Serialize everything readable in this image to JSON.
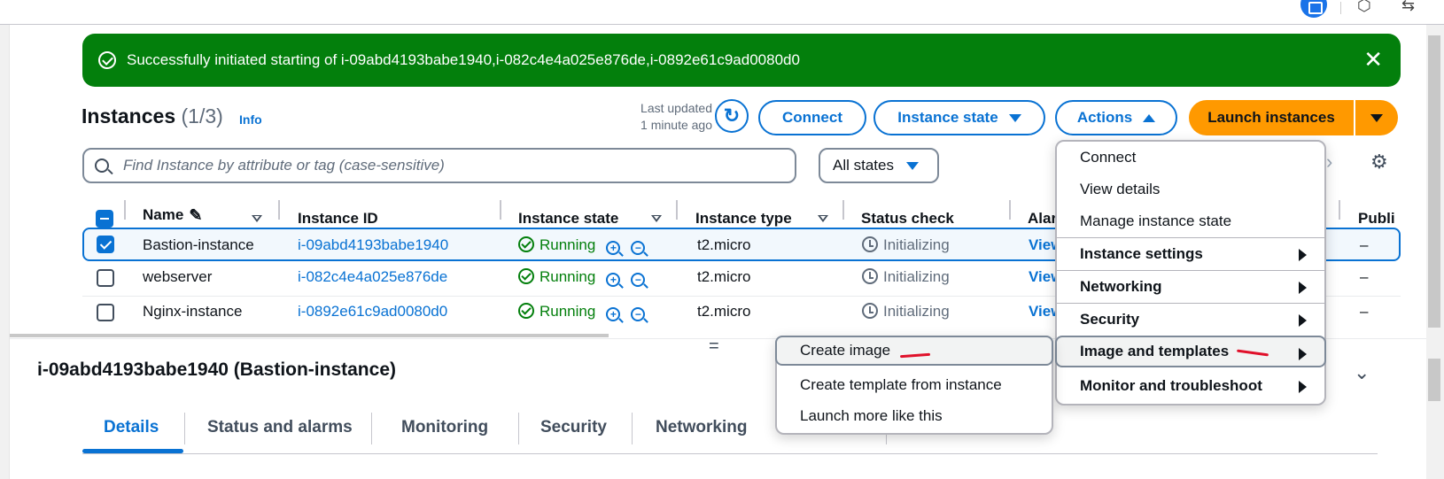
{
  "flash": {
    "message": "Successfully initiated starting of i-09abd4193babe1940,i-082c4e4a025e876de,i-0892e61c9ad0080d0",
    "color": "#037f0c"
  },
  "header": {
    "title": "Instances",
    "count": "(1/3)",
    "info": "Info",
    "last_updated_line1": "Last updated",
    "last_updated_line2": "1 minute ago"
  },
  "toolbar": {
    "connect": "Connect",
    "instance_state": "Instance state",
    "actions": "Actions",
    "launch": "Launch instances"
  },
  "filter": {
    "search_placeholder": "Find Instance by attribute or tag (case-sensitive)",
    "states": "All states"
  },
  "table": {
    "columns": [
      "Name",
      "Instance ID",
      "Instance state",
      "Instance type",
      "Status check",
      "Alar",
      "Publi"
    ],
    "rows": [
      {
        "name": "Bastion-instance",
        "id": "i-09abd4193babe1940",
        "state": "Running",
        "type": "t2.micro",
        "status": "Initializing",
        "alarm": "View",
        "public": "–",
        "selected": true
      },
      {
        "name": "webserver",
        "id": "i-082c4e4a025e876de",
        "state": "Running",
        "type": "t2.micro",
        "status": "Initializing",
        "alarm": "View",
        "public": "–",
        "selected": false
      },
      {
        "name": "Nginx-instance",
        "id": "i-0892e61c9ad0080d0",
        "state": "Running",
        "type": "t2.micro",
        "status": "Initializing",
        "alarm": "View",
        "public": "–",
        "selected": false
      }
    ]
  },
  "details": {
    "title": "i-09abd4193babe1940 (Bastion-instance)",
    "tabs": [
      "Details",
      "Status and alarms",
      "Monitoring",
      "Security",
      "Networking"
    ],
    "splitter": "="
  },
  "actions_menu": {
    "items": [
      {
        "label": "Connect",
        "bold": false
      },
      {
        "label": "View details",
        "bold": false
      },
      {
        "label": "Manage instance state",
        "bold": false
      },
      {
        "label": "Instance settings",
        "bold": true
      },
      {
        "label": "Networking",
        "bold": true
      },
      {
        "label": "Security",
        "bold": true
      },
      {
        "label": "Image and templates",
        "bold": true
      },
      {
        "label": "Monitor and troubleshoot",
        "bold": true
      }
    ]
  },
  "submenu": {
    "items": [
      "Create image",
      "Create template from instance",
      "Launch more like this"
    ]
  },
  "colors": {
    "accent": "#0972d3",
    "launch": "#ff9900",
    "success": "#037f0c",
    "annotation": "#e0102a"
  }
}
